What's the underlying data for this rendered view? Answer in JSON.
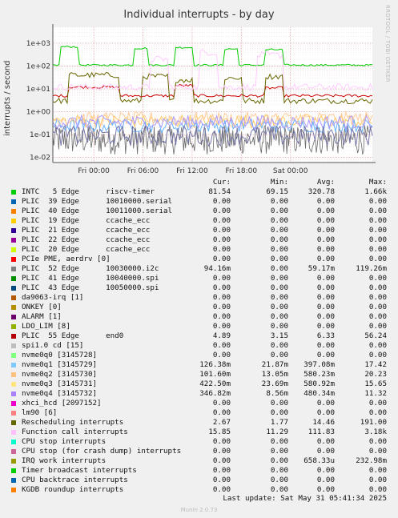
{
  "chart_data": {
    "type": "line",
    "title": "Individual interrupts - by day",
    "ylabel": "interrupts / second",
    "yscale": "log",
    "ylim": [
      0.006,
      5000
    ],
    "y_ticks": [
      0.01,
      0.1,
      1,
      10,
      100,
      1000
    ],
    "y_tick_labels": [
      "1e-02",
      "1e-01",
      "1e+00",
      "1e+01",
      "1e+02",
      "1e+03"
    ],
    "x_tick_labels": [
      "Fri 00:00",
      "Fri 06:00",
      "Fri 12:00",
      "Fri 18:00",
      "Sat 00:00"
    ],
    "x_range_hours": [
      -5,
      34
    ],
    "x_tick_hours": [
      0,
      6,
      12,
      18,
      24
    ],
    "grid": true,
    "series": [
      {
        "name": "INTC   5 Edge      riscv-timer",
        "color": "#00cc00",
        "base": 110,
        "amp": 0.08,
        "spikes": [
          [
            -4,
            -2,
            700
          ],
          [
            5,
            6.5,
            600
          ],
          [
            10,
            12,
            650
          ],
          [
            16,
            17.5,
            560
          ],
          [
            21,
            23,
            520
          ]
        ]
      },
      {
        "name": "PLIC  55 Edge      end0",
        "color": "#cc0000",
        "base": 5,
        "amp": 0.12,
        "spikes": [
          [
            -3,
            3,
            12
          ],
          [
            10,
            12,
            14
          ],
          [
            21,
            23,
            11
          ]
        ]
      },
      {
        "name": "Rescheduling interrupts",
        "color": "#666600",
        "base": 3,
        "amp": 0.25,
        "spikes": [
          [
            -3,
            3,
            40
          ],
          [
            6,
            9,
            35
          ],
          [
            10,
            12,
            25
          ],
          [
            16,
            18,
            30
          ],
          [
            21,
            23,
            35
          ]
        ]
      },
      {
        "name": "Function call interrupts",
        "color": "#ffccff",
        "base": 12,
        "amp": 0.3,
        "spikes": [
          [
            7,
            9,
            200
          ],
          [
            13,
            15,
            400
          ],
          [
            20,
            23,
            300
          ]
        ]
      },
      {
        "name": "IRQ work interrupts",
        "color": "#ffcc66",
        "base": 0.4,
        "amp": 0.6,
        "spikes": []
      },
      {
        "name": "nvme0q1 [3145729]",
        "color": "#66b3ff",
        "base": 0.25,
        "amp": 0.6,
        "spikes": []
      },
      {
        "name": "nvme0q3 [3145731]",
        "color": "#ffcc99",
        "base": 0.5,
        "amp": 0.6,
        "spikes": []
      },
      {
        "name": "nvme0q4 [3145732]",
        "color": "#aa99ff",
        "base": 0.35,
        "amp": 0.6,
        "spikes": []
      },
      {
        "name": "PLIC  52 Edge      10030000.i2c",
        "color": "#7777aa",
        "base": 0.09,
        "amp": 0.9,
        "spikes": []
      }
    ],
    "legend_columns": [
      "Cur:",
      "Min:",
      "Avg:",
      "Max:"
    ],
    "legend": [
      {
        "name": "INTC   5 Edge      riscv-timer",
        "color": "#00cc00",
        "cur": "81.54",
        "min": "69.15",
        "avg": "320.78",
        "max": "1.66k"
      },
      {
        "name": "PLIC  39 Edge      10010000.serial",
        "color": "#0066b3",
        "cur": "0.00",
        "min": "0.00",
        "avg": "0.00",
        "max": "0.00"
      },
      {
        "name": "PLIC  40 Edge      10011000.serial",
        "color": "#ff8000",
        "cur": "0.00",
        "min": "0.00",
        "avg": "0.00",
        "max": "0.00"
      },
      {
        "name": "PLIC  19 Edge      ccache_ecc",
        "color": "#ffcc00",
        "cur": "0.00",
        "min": "0.00",
        "avg": "0.00",
        "max": "0.00"
      },
      {
        "name": "PLIC  21 Edge      ccache_ecc",
        "color": "#330099",
        "cur": "0.00",
        "min": "0.00",
        "avg": "0.00",
        "max": "0.00"
      },
      {
        "name": "PLIC  22 Edge      ccache_ecc",
        "color": "#990099",
        "cur": "0.00",
        "min": "0.00",
        "avg": "0.00",
        "max": "0.00"
      },
      {
        "name": "PLIC  20 Edge      ccache_ecc",
        "color": "#ccff00",
        "cur": "0.00",
        "min": "0.00",
        "avg": "0.00",
        "max": "0.00"
      },
      {
        "name": "PCIe PME, aerdrv [0]",
        "color": "#ff0000",
        "cur": "0.00",
        "min": "0.00",
        "avg": "0.00",
        "max": "0.00"
      },
      {
        "name": "PLIC  52 Edge      10030000.i2c",
        "color": "#808080",
        "cur": "94.16m",
        "min": "0.00",
        "avg": "59.17m",
        "max": "119.26m"
      },
      {
        "name": "PLIC  41 Edge      10040000.spi",
        "color": "#008f00",
        "cur": "0.00",
        "min": "0.00",
        "avg": "0.00",
        "max": "0.00"
      },
      {
        "name": "PLIC  43 Edge      10050000.spi",
        "color": "#00487d",
        "cur": "0.00",
        "min": "0.00",
        "avg": "0.00",
        "max": "0.00"
      },
      {
        "name": "da9063-irq [1]",
        "color": "#b35a00",
        "cur": "0.00",
        "min": "0.00",
        "avg": "0.00",
        "max": "0.00"
      },
      {
        "name": "ONKEY [0]",
        "color": "#b38f00",
        "cur": "0.00",
        "min": "0.00",
        "avg": "0.00",
        "max": "0.00"
      },
      {
        "name": "ALARM [1]",
        "color": "#6b006b",
        "cur": "0.00",
        "min": "0.00",
        "avg": "0.00",
        "max": "0.00"
      },
      {
        "name": "LDO_LIM [8]",
        "color": "#8fb300",
        "cur": "0.00",
        "min": "0.00",
        "avg": "0.00",
        "max": "0.00"
      },
      {
        "name": "PLIC  55 Edge      end0",
        "color": "#b30000",
        "cur": "4.89",
        "min": "3.15",
        "avg": "6.33",
        "max": "56.24"
      },
      {
        "name": "spi1.0 cd [15]",
        "color": "#bebebe",
        "cur": "0.00",
        "min": "0.00",
        "avg": "0.00",
        "max": "0.00"
      },
      {
        "name": "nvme0q0 [3145728]",
        "color": "#80ff80",
        "cur": "0.00",
        "min": "0.00",
        "avg": "0.00",
        "max": "0.00"
      },
      {
        "name": "nvme0q1 [3145729]",
        "color": "#80c9ff",
        "cur": "126.38m",
        "min": "21.87m",
        "avg": "397.08m",
        "max": "17.42"
      },
      {
        "name": "nvme0q2 [3145730]",
        "color": "#ffc080",
        "cur": "101.60m",
        "min": "13.05m",
        "avg": "580.23m",
        "max": "20.23"
      },
      {
        "name": "nvme0q3 [3145731]",
        "color": "#ffe680",
        "cur": "422.50m",
        "min": "23.69m",
        "avg": "580.92m",
        "max": "15.65"
      },
      {
        "name": "nvme0q4 [3145732]",
        "color": "#aa80ff",
        "cur": "346.82m",
        "min": "8.56m",
        "avg": "480.34m",
        "max": "11.32"
      },
      {
        "name": "xhci_hcd [2097152]",
        "color": "#ee00cc",
        "cur": "0.00",
        "min": "0.00",
        "avg": "0.00",
        "max": "0.00"
      },
      {
        "name": "lm90 [6]",
        "color": "#ff8080",
        "cur": "0.00",
        "min": "0.00",
        "avg": "0.00",
        "max": "0.00"
      },
      {
        "name": "Rescheduling interrupts",
        "color": "#666600",
        "cur": "2.67",
        "min": "1.77",
        "avg": "14.46",
        "max": "191.00"
      },
      {
        "name": "Function call interrupts",
        "color": "#ffbfff",
        "cur": "15.85",
        "min": "11.29",
        "avg": "111.83",
        "max": "3.18k"
      },
      {
        "name": "CPU stop interrupts",
        "color": "#00ffcc",
        "cur": "0.00",
        "min": "0.00",
        "avg": "0.00",
        "max": "0.00"
      },
      {
        "name": "CPU stop (for crash dump) interrupts",
        "color": "#cc6699",
        "cur": "0.00",
        "min": "0.00",
        "avg": "0.00",
        "max": "0.00"
      },
      {
        "name": "IRQ work interrupts",
        "color": "#999900",
        "cur": "0.00",
        "min": "0.00",
        "avg": "658.33u",
        "max": "232.98m"
      },
      {
        "name": "Timer broadcast interrupts",
        "color": "#00cc00",
        "cur": "0.00",
        "min": "0.00",
        "avg": "0.00",
        "max": "0.00"
      },
      {
        "name": "CPU backtrace interrupts",
        "color": "#0066b3",
        "cur": "0.00",
        "min": "0.00",
        "avg": "0.00",
        "max": "0.00"
      },
      {
        "name": "KGDB roundup interrupts",
        "color": "#ff8000",
        "cur": "0.00",
        "min": "0.00",
        "avg": "0.00",
        "max": "0.00"
      }
    ]
  },
  "side_credit": "RRDTOOL / TOBI OETIKER",
  "last_update": "Last update: Sat May 31 05:41:34 2025",
  "generator": "Munin 2.0.73"
}
